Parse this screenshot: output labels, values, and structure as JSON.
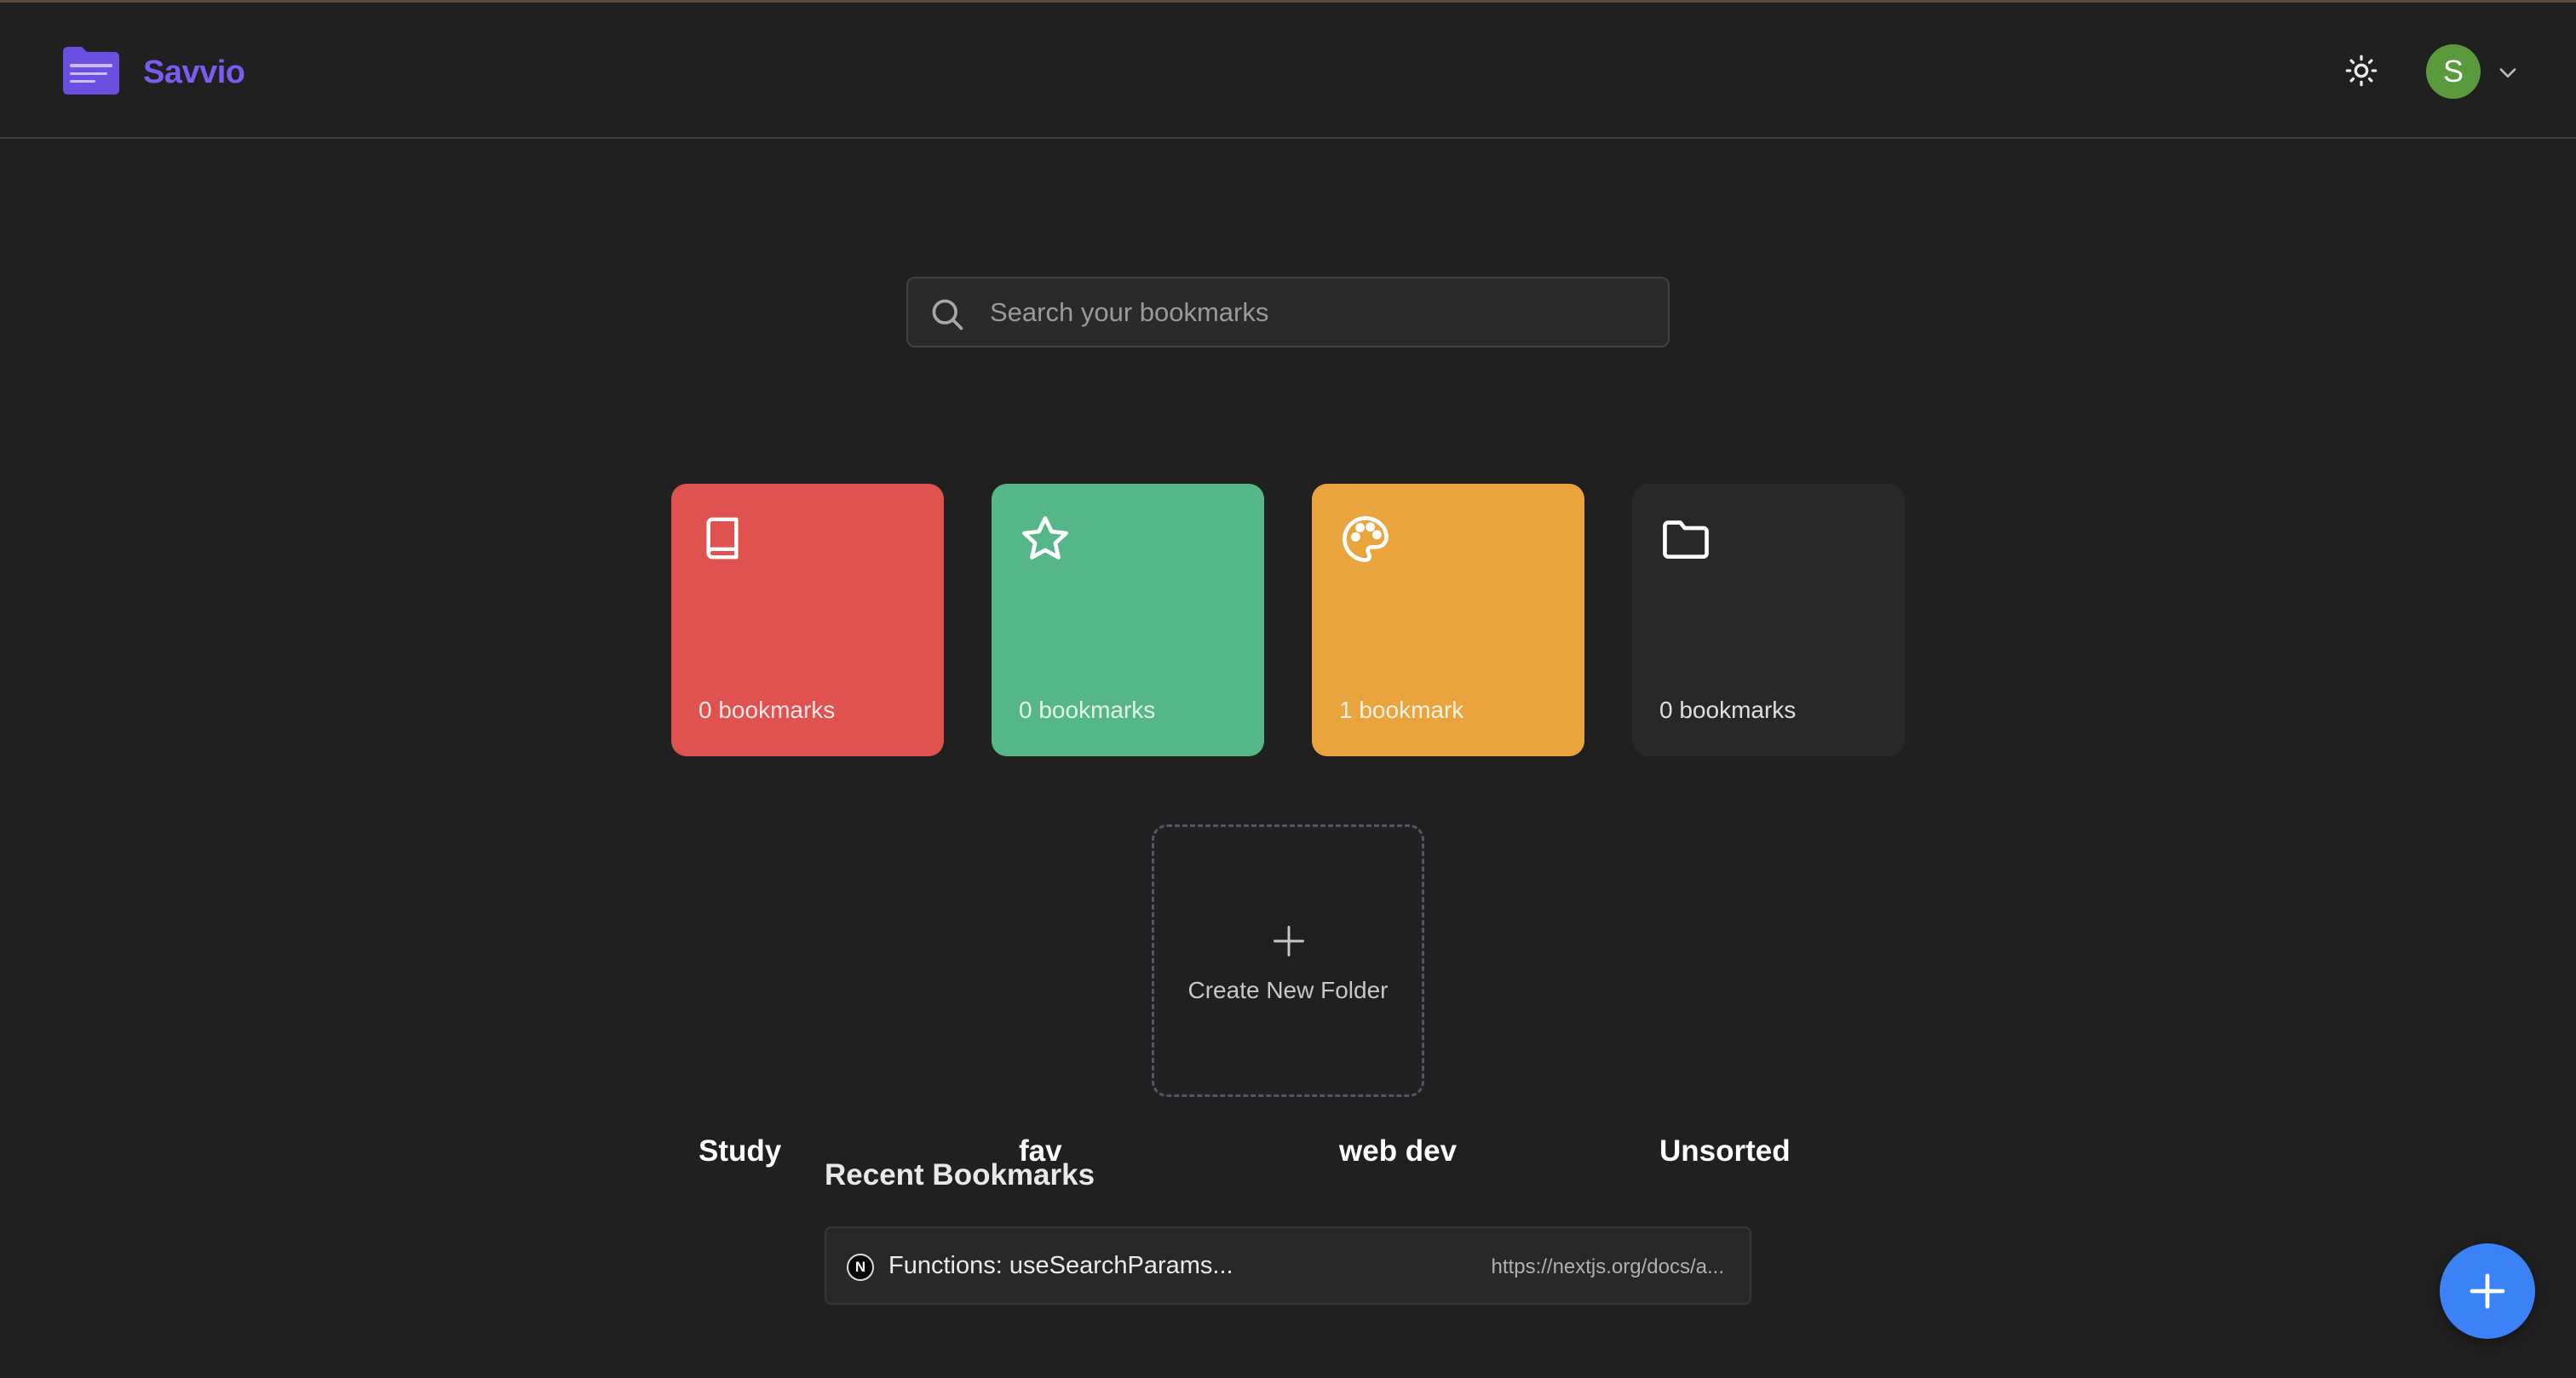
{
  "app": {
    "name": "Savvio",
    "brand_color": "#7c5cf0"
  },
  "header": {
    "theme_icon": "sun-icon",
    "user": {
      "initial": "S",
      "avatar_color": "#5b9a3c"
    },
    "menu_icon": "chevron-down-icon"
  },
  "search": {
    "placeholder": "Search your bookmarks",
    "value": ""
  },
  "folders": [
    {
      "name": "Study",
      "count": "0 bookmarks",
      "icon": "book-icon",
      "color": "#df5250"
    },
    {
      "name": "fav",
      "count": "0 bookmarks",
      "icon": "star-icon",
      "color": "#55b788"
    },
    {
      "name": "web dev",
      "count": "1 bookmark",
      "icon": "palette-icon",
      "color": "#e9a43e"
    },
    {
      "name": "Unsorted",
      "count": "0 bookmarks",
      "icon": "folder-icon",
      "color": "#282828"
    }
  ],
  "create_folder": {
    "label": "Create New Folder",
    "icon": "plus-icon"
  },
  "recent": {
    "title": "Recent Bookmarks",
    "items": [
      {
        "title": "Functions: useSearchParams...",
        "url": "https://nextjs.org/docs/a...",
        "favicon": "N"
      }
    ]
  },
  "fab": {
    "icon": "plus-icon",
    "color": "#3b82f6"
  }
}
